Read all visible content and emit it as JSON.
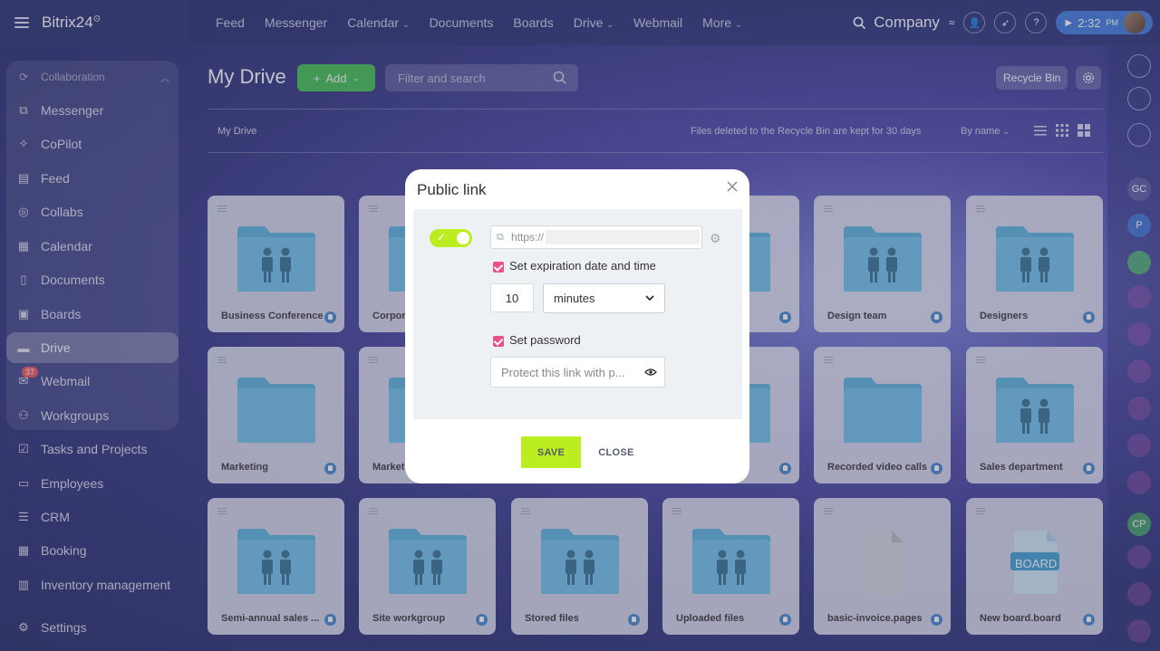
{
  "app": {
    "logo": "Bitrix24",
    "logo_mark": "⊙"
  },
  "topnav": [
    {
      "label": "Feed",
      "chevron": ""
    },
    {
      "label": "Messenger",
      "chevron": ""
    },
    {
      "label": "Calendar",
      "chevron": "⌄"
    },
    {
      "label": "Documents",
      "chevron": ""
    },
    {
      "label": "Boards",
      "chevron": ""
    },
    {
      "label": "Drive",
      "chevron": "⌄"
    },
    {
      "label": "Webmail",
      "chevron": ""
    },
    {
      "label": "More",
      "chevron": "⌄"
    }
  ],
  "header": {
    "company": "Company",
    "time": "2:32",
    "time_suffix": "PM"
  },
  "sidebar": {
    "section": "Collaboration",
    "items": [
      {
        "label": "Messenger",
        "icon": "messenger-icon"
      },
      {
        "label": "CoPilot",
        "icon": "copilot-icon"
      },
      {
        "label": "Feed",
        "icon": "feed-icon"
      },
      {
        "label": "Collabs",
        "icon": "collabs-icon"
      },
      {
        "label": "Calendar",
        "icon": "calendar-icon"
      },
      {
        "label": "Documents",
        "icon": "documents-icon"
      },
      {
        "label": "Boards",
        "icon": "boards-icon"
      },
      {
        "label": "Drive",
        "icon": "drive-icon"
      },
      {
        "label": "Webmail",
        "icon": "mail-icon",
        "badge": "37"
      },
      {
        "label": "Workgroups",
        "icon": "workgroups-icon"
      },
      {
        "label": "Tasks and Projects",
        "icon": "tasks-icon"
      },
      {
        "label": "Employees",
        "icon": "employees-icon"
      },
      {
        "label": "CRM",
        "icon": "crm-icon"
      },
      {
        "label": "Booking",
        "icon": "booking-icon"
      },
      {
        "label": "Inventory management",
        "icon": "inventory-icon"
      },
      {
        "label": "Settings",
        "icon": "settings-icon"
      }
    ]
  },
  "page": {
    "title": "My Drive",
    "add_label": "Add",
    "filter_placeholder": "Filter and search",
    "recycle_bin": "Recycle Bin",
    "breadcrumb": "My Drive",
    "notice": "Files deleted to the Recycle Bin are kept for 30 days",
    "sort": "By name"
  },
  "files": [
    {
      "name": "Business Conference",
      "kind": "group-folder"
    },
    {
      "name": "Corpor",
      "kind": "group-folder"
    },
    {
      "name": "",
      "kind": "group-folder"
    },
    {
      "name": "",
      "kind": "group-folder"
    },
    {
      "name": "Design team",
      "kind": "group-folder"
    },
    {
      "name": "Designers",
      "kind": "group-folder"
    },
    {
      "name": "Marketing",
      "kind": "folder"
    },
    {
      "name": "Market",
      "kind": "group-folder"
    },
    {
      "name": "",
      "kind": "group-folder"
    },
    {
      "name": "ion",
      "kind": "group-folder"
    },
    {
      "name": "Recorded video calls",
      "kind": "folder"
    },
    {
      "name": "Sales department",
      "kind": "group-folder"
    },
    {
      "name": "Semi-annual sales ...",
      "kind": "group-folder"
    },
    {
      "name": "Site workgroup",
      "kind": "group-folder"
    },
    {
      "name": "Stored files",
      "kind": "group-folder"
    },
    {
      "name": "Uploaded files",
      "kind": "group-folder"
    },
    {
      "name": "basic-invoice.pages",
      "kind": "file"
    },
    {
      "name": "New board.board",
      "kind": "board",
      "board_label": "BOARD"
    }
  ],
  "rail": [
    {
      "icon": "bell-icon",
      "text": ""
    },
    {
      "icon": "copilot-rail-icon",
      "text": ""
    },
    {
      "icon": "chat-rail-icon",
      "text": ""
    },
    {
      "icon": "avatar-gc",
      "text": "GC"
    },
    {
      "icon": "avatar-p",
      "text": "P"
    },
    {
      "icon": "contact-card-icon",
      "text": ""
    },
    {
      "icon": "avatar-cp",
      "text": "CP"
    }
  ],
  "modal": {
    "title": "Public link",
    "link_enabled": true,
    "url_prefix": "https://",
    "expiration_label": "Set expiration date and time",
    "expiration_checked": true,
    "expiration_value": "10",
    "expiration_unit": "minutes",
    "password_label": "Set password",
    "password_checked": true,
    "password_placeholder": "Protect this link with p...",
    "save_label": "SAVE",
    "close_label": "CLOSE"
  },
  "colors": {
    "accent_green": "#bbed21",
    "checkbox_pink": "#e94f89",
    "add_button": "#3bbf47",
    "folder_blue": "#55b3db",
    "time_pill": "#3a79d9"
  }
}
